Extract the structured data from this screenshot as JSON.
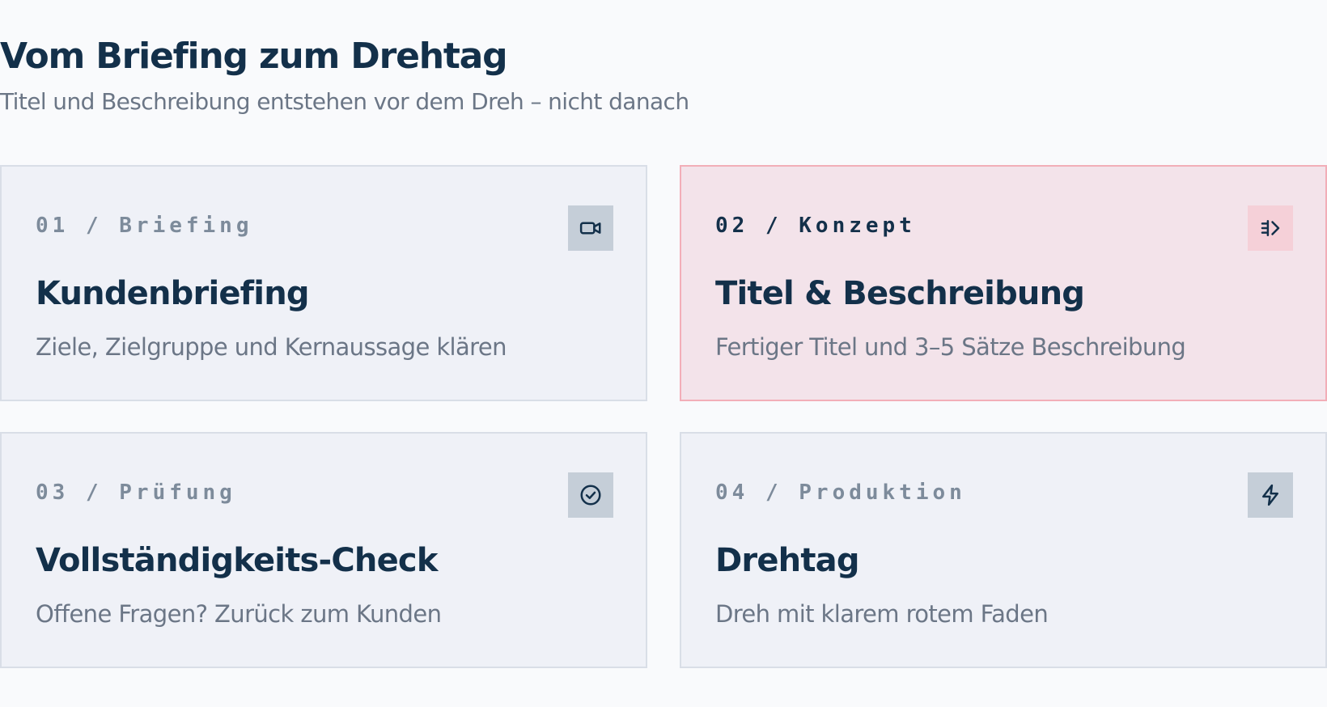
{
  "header": {
    "title": "Vom Briefing zum Drehtag",
    "subtitle": "Titel und Beschreibung entstehen vor dem Dreh – nicht danach"
  },
  "cards": [
    {
      "step": "01 / Briefing",
      "title": "Kundenbriefing",
      "description": "Ziele, Zielgruppe und Kernaussage klären",
      "icon": "video-camera-icon",
      "highlighted": false
    },
    {
      "step": "02 / Konzept",
      "title": "Titel & Beschreibung",
      "description": "Fertiger Titel und 3–5 Sätze Beschreibung",
      "icon": "text-cursor-icon",
      "highlighted": true
    },
    {
      "step": "03 / Prüfung",
      "title": "Vollständigkeits-Check",
      "description": "Offene Fragen? Zurück zum Kunden",
      "icon": "check-circle-icon",
      "highlighted": false
    },
    {
      "step": "04 / Produktion",
      "title": "Drehtag",
      "description": "Dreh mit klarem rotem Faden",
      "icon": "lightning-icon",
      "highlighted": false
    }
  ],
  "colors": {
    "primary_text": "#13304a",
    "muted_text": "#6b7686",
    "card_bg": "#eff1f7",
    "highlight_bg": "#f3e3ea",
    "highlight_border": "#f2aeb8"
  }
}
